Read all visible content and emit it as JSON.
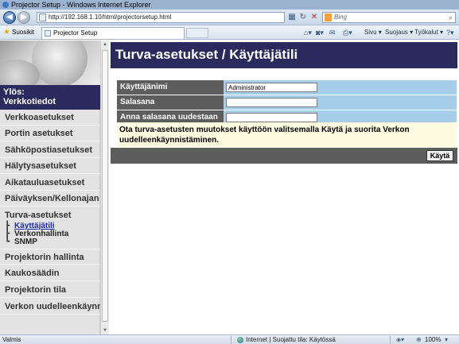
{
  "window": {
    "title": "Projector Setup - Windows Internet Explorer"
  },
  "address_bar": {
    "url": "http://192.168.1.10/html/projectorsetup.html",
    "search_placeholder": "Bing"
  },
  "favorites_bar": {
    "favorites_label": "Suosikit",
    "tab_title": "Projector Setup",
    "commands": {
      "page": "Sivu ▾",
      "safety": "Suojaus ▾",
      "tools": "Työkalut ▾"
    }
  },
  "sidebar": {
    "up_label": "Ylös:\nVerkkotiedot",
    "items": [
      {
        "label": "Verkkoasetukset"
      },
      {
        "label": "Portin asetukset"
      },
      {
        "label": "Sähköpostiasetukset"
      },
      {
        "label": "Hälytysasetukset"
      },
      {
        "label": "Aikatauluasetukset"
      },
      {
        "label": "Päiväyksen/Kellonajan asetukset"
      },
      {
        "label": "Turva-asetukset"
      }
    ],
    "sub_items": [
      {
        "label": "Käyttäjätili",
        "active": true
      },
      {
        "label": "Verkonhallinta",
        "active": false
      },
      {
        "label": "SNMP",
        "active": false
      }
    ],
    "items_after": [
      {
        "label": "Projektorin hallinta"
      },
      {
        "label": "Kaukosäädin"
      },
      {
        "label": "Projektorin tila"
      },
      {
        "label": "Verkon uudelleenkäynnistys"
      }
    ]
  },
  "main": {
    "title": "Turva-asetukset / Käyttäjätili",
    "fields": [
      {
        "label": "Käyttäjänimi",
        "value": "Administrator"
      },
      {
        "label": "Salasana",
        "value": ""
      },
      {
        "label": "Anna salasana uudestaan",
        "value": ""
      }
    ],
    "info_text": "Ota turva-asetusten muutokset käyttöön valitsemalla Käytä ja suorita Verkon uudelleenkäynnistäminen.",
    "apply_label": "Käytä"
  },
  "status_bar": {
    "status": "Valmis",
    "zone": "Internet | Suojattu tila: Käytössä",
    "zoom": "100%"
  },
  "colors": {
    "header_bg": "#2a2a5e",
    "label_bg": "#5d5d5d",
    "field_cell_bg": "#a6cdea",
    "info_bg": "#fffbe0",
    "active_link": "#1a2da8"
  }
}
